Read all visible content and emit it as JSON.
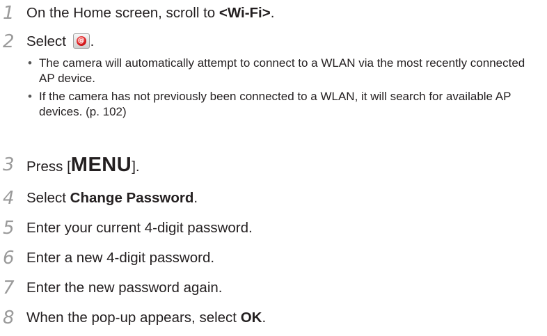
{
  "steps": [
    {
      "num": "1",
      "pre": "On the Home screen, scroll to ",
      "bold": "<Wi-Fi>",
      "post": "."
    },
    {
      "num": "2",
      "pre": "Select ",
      "post": "."
    },
    {
      "num": "3",
      "pre": "Press [",
      "key": "MENU",
      "post": "]."
    },
    {
      "num": "4",
      "pre": "Select ",
      "bold": "Change Password",
      "post": "."
    },
    {
      "num": "5",
      "text": "Enter your current 4-digit password."
    },
    {
      "num": "6",
      "text": "Enter a new 4-digit password."
    },
    {
      "num": "7",
      "text": "Enter the new password again."
    },
    {
      "num": "8",
      "pre": "When the pop-up appears, select ",
      "bold": "OK",
      "post": "."
    }
  ],
  "notes": [
    "The camera will automatically attempt to connect to a WLAN via the most recently connected AP device.",
    "If the camera has not previously been connected to a WLAN, it will search for available AP devices. (p. 102)"
  ],
  "icons": {
    "wifi_app": "wifi-app-icon",
    "wifi_app_symbol": "@"
  },
  "colors": {
    "step_number": "#9a9a9a",
    "text": "#231f20",
    "icon_red": "#d8181b"
  }
}
